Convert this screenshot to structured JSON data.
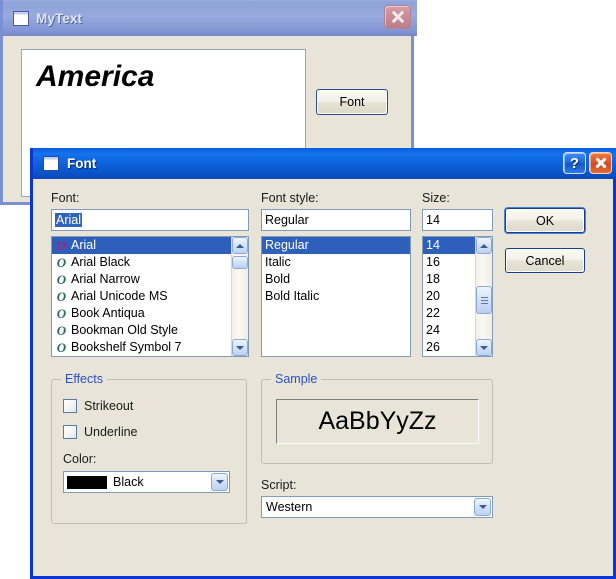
{
  "mytext_window": {
    "title": "MyText",
    "icon": "window-icon",
    "close_label": "X",
    "editor_text": "America",
    "font_button_label": "Font"
  },
  "font_dialog": {
    "title": "Font",
    "icon": "window-icon",
    "help_label": "?",
    "close_label": "X",
    "font": {
      "label": "Font:",
      "value": "Arial",
      "items": [
        "Arial",
        "Arial Black",
        "Arial Narrow",
        "Arial Unicode MS",
        "Book Antiqua",
        "Bookman Old Style",
        "Bookshelf Symbol 7"
      ],
      "selected_index": 0,
      "item_icon": "opentype-icon",
      "item_icon_glyph": "O"
    },
    "font_style": {
      "label": "Font style:",
      "value": "Regular",
      "items": [
        "Regular",
        "Italic",
        "Bold",
        "Bold Italic"
      ],
      "selected_index": 0
    },
    "size": {
      "label": "Size:",
      "value": "14",
      "items": [
        "14",
        "16",
        "18",
        "20",
        "22",
        "24",
        "26"
      ],
      "selected_index": 0
    },
    "buttons": {
      "ok": "OK",
      "cancel": "Cancel"
    },
    "effects": {
      "title": "Effects",
      "strikeout_label": "Strikeout",
      "strikeout_checked": false,
      "underline_label": "Underline",
      "underline_checked": false,
      "color_label": "Color:",
      "color_value": "Black",
      "color_hex": "#000000"
    },
    "sample": {
      "title": "Sample",
      "text": "AaBbYyZz"
    },
    "script": {
      "label": "Script:",
      "value": "Western"
    },
    "colors": {
      "dialog_bg": "#e8e5d8",
      "titlebar_blue": "#0d62db",
      "selection_blue": "#2e5fbb",
      "group_label_blue": "#2b4fc8",
      "border_blue": "#0b35d4"
    }
  }
}
